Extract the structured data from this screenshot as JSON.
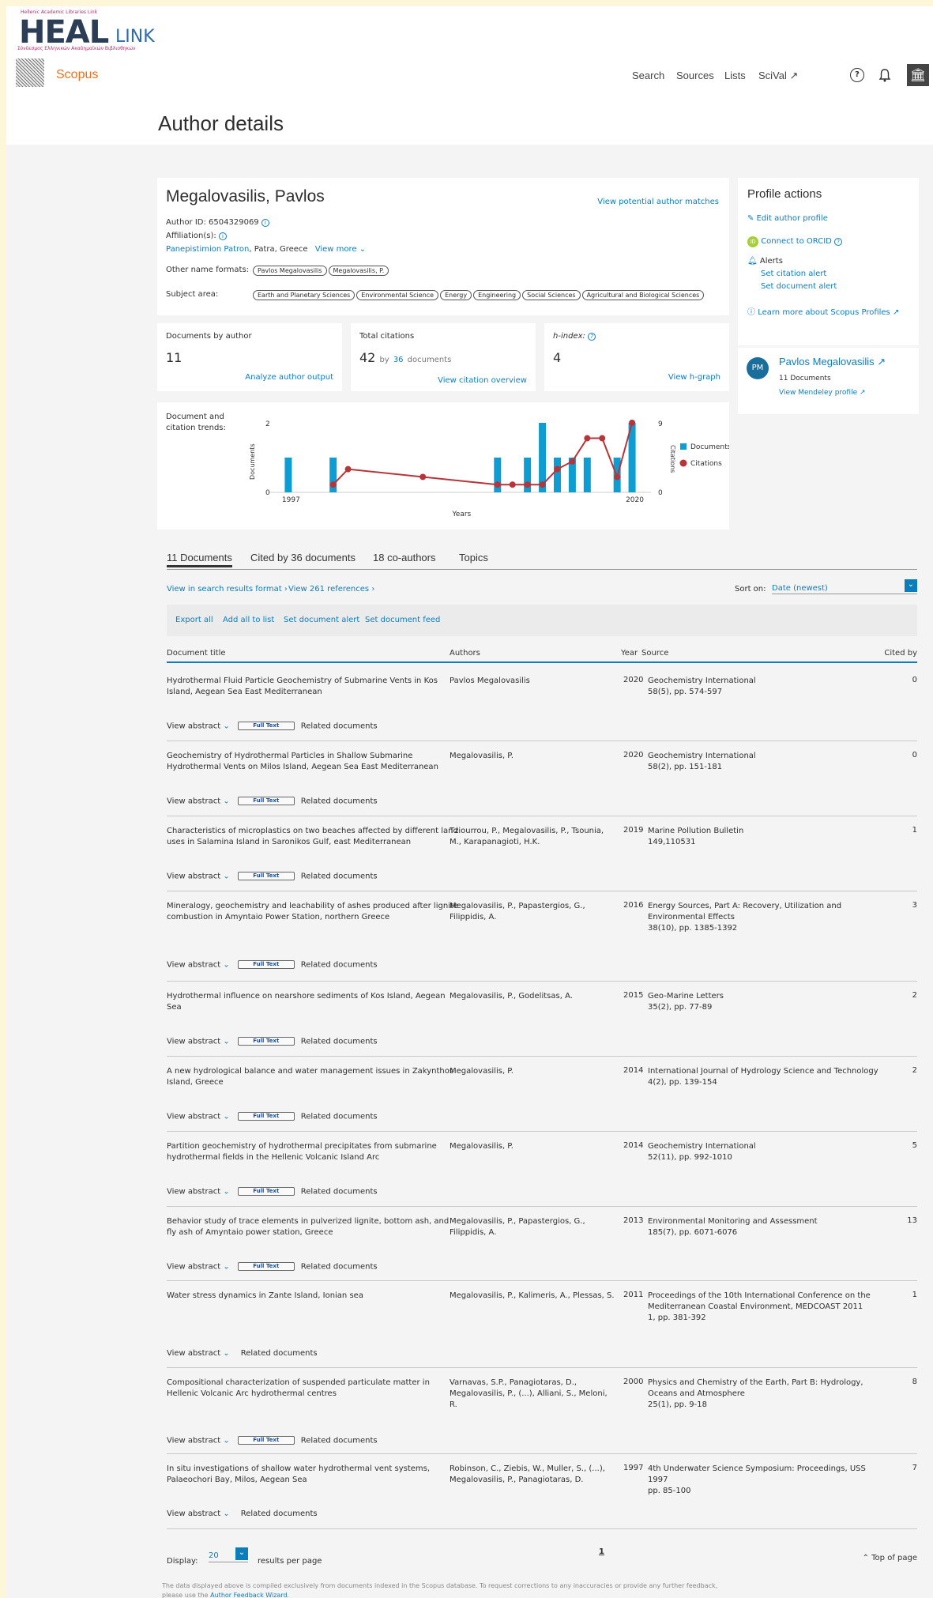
{
  "header": {
    "heal_small": "Hellenic Academic Libraries Link",
    "heal_big": "HEAL",
    "heal_link": "LINK",
    "heal_greek": "Σύνδεσμος Ελληνικών Ακαδημαϊκών Βιβλιοθηκών",
    "brand": "Scopus",
    "nav": [
      "Search",
      "Sources",
      "Lists",
      "SciVal ↗"
    ],
    "help_icon": "?",
    "inst_icon": "🏛"
  },
  "page_title": "Author details",
  "author": {
    "name": "Megalovasilis, Pavlos",
    "author_id": "Author ID: 6504329069",
    "affiliation_label": "Affiliation(s):",
    "affiliation_link": "Panepistimion Patron",
    "affiliation_rest": ", Patra, Greece",
    "view_more": "View more",
    "potential_matches": "View potential author matches",
    "other_names_label": "Other name formats:",
    "other_names": [
      "Pavlos Megalovasilis",
      "Megalovasilis, P."
    ],
    "subject_label": "Subject area:",
    "subjects": [
      "Earth and Planetary Sciences",
      "Environmental Science",
      "Energy",
      "Engineering",
      "Social Sciences",
      "Agricultural and Biological Sciences"
    ]
  },
  "metrics": {
    "docs_label": "Documents by author",
    "docs_value": "11",
    "docs_link": "Analyze author output",
    "cit_label": "Total citations",
    "cit_value": "42",
    "cit_by": "by",
    "cit_docs_num": "36",
    "cit_docs_word": "documents",
    "cit_link": "View citation overview",
    "h_label": "h-index:",
    "h_value": "4",
    "h_link": "View h-graph"
  },
  "profile_actions": {
    "title": "Profile actions",
    "edit": "Edit author profile",
    "orcid": "Connect to ORCID",
    "alerts": "Alerts",
    "citation_alert": "Set citation alert",
    "document_alert": "Set document alert",
    "learn_more": "Learn more about Scopus Profiles"
  },
  "mendeley": {
    "initials": "PM",
    "name": "Pavlos Megalovasilis",
    "docs": "11 Documents",
    "view": "View Mendeley profile"
  },
  "trend_label": "Document and citation trends:",
  "chart_data": {
    "type": "bar",
    "xlabel": "Years",
    "ylabel": "Documents",
    "y2label": "Citations",
    "x_tick_labels": [
      "1997",
      "2020"
    ],
    "ylim": [
      0,
      2
    ],
    "y2lim": [
      0,
      9
    ],
    "y_ticks": [
      "0",
      "2"
    ],
    "y2_ticks": [
      "0",
      "9"
    ],
    "legend_position": "right",
    "series": [
      {
        "name": "Documents",
        "color": "#0e9dd3",
        "kind": "bar",
        "x": [
          1997,
          2000,
          2011,
          2013,
          2014,
          2015,
          2016,
          2017,
          2019,
          2020
        ],
        "values": [
          1,
          1,
          1,
          1,
          2,
          1,
          1,
          1,
          1,
          2
        ]
      },
      {
        "name": "Citations",
        "color": "#b7343a",
        "kind": "line",
        "x": [
          2000,
          2001,
          2006,
          2011,
          2012,
          2013,
          2014,
          2015,
          2016,
          2017,
          2018,
          2019,
          2020
        ],
        "values": [
          1,
          3,
          2,
          1,
          1,
          1,
          1,
          3,
          4,
          7,
          7,
          2,
          9
        ]
      }
    ],
    "xlim": [
      1996,
      2021
    ]
  },
  "tabs": [
    "11 Documents",
    "Cited by 36 documents",
    "18 co-authors",
    "Topics"
  ],
  "search_links": {
    "results_format": "View in search results format",
    "references": "View 261 references"
  },
  "sort": {
    "label": "Sort on:",
    "value": "Date (newest)"
  },
  "toolbar": [
    "Export all",
    "Add all to list",
    "Set document alert",
    "Set document feed"
  ],
  "table_headers": {
    "title": "Document title",
    "authors": "Authors",
    "year": "Year",
    "source": "Source",
    "cited": "Cited by"
  },
  "row_actions": {
    "abstract": "View abstract",
    "fulltext": "Full Text",
    "related": "Related documents"
  },
  "documents": [
    {
      "title": "Hydrothermal Fluid Particle Geochemistry of Submarine Vents in Kos Island, Aegean Sea East Mediterranean",
      "authors": "Pavlos Megalovasilis",
      "year": "2020",
      "source": "Geochemistry International",
      "source2": "58(5), pp. 574-597",
      "cited": "0",
      "fulltext": true
    },
    {
      "title": "Geochemistry of Hydrothermal Particles in Shallow Submarine Hydrothermal Vents on Milos Island, Aegean Sea East Mediterranean",
      "authors": "Megalovasilis, P.",
      "year": "2020",
      "source": "Geochemistry International",
      "source2": "58(2), pp. 151-181",
      "cited": "0",
      "fulltext": true
    },
    {
      "title": "Characteristics of microplastics on two beaches affected by different land uses in Salamina Island in Saronikos Gulf, east Mediterranean",
      "authors": "Tziourrou, P., Megalovasilis, P., Tsounia, M., Karapanagioti, H.K.",
      "year": "2019",
      "source": "Marine Pollution Bulletin",
      "source2": "149,110531",
      "cited": "1",
      "fulltext": true
    },
    {
      "title": "Mineralogy, geochemistry and leachability of ashes produced after lignite combustion in Amyntaio Power Station, northern Greece",
      "authors": "Megalovasilis, P., Papastergios, G., Filippidis, A.",
      "year": "2016",
      "source": "Energy Sources, Part A: Recovery, Utilization and Environmental Effects",
      "source2": "38(10), pp. 1385-1392",
      "cited": "3",
      "fulltext": true
    },
    {
      "title": "Hydrothermal influence on nearshore sediments of Kos Island, Aegean Sea",
      "authors": "Megalovasilis, P., Godelitsas, A.",
      "year": "2015",
      "source": "Geo-Marine Letters",
      "source2": "35(2), pp. 77-89",
      "cited": "2",
      "fulltext": true
    },
    {
      "title": "A new hydrological balance and water management issues in Zakynthos Island, Greece",
      "authors": "Megalovasilis, P.",
      "year": "2014",
      "source": "International Journal of Hydrology Science and Technology",
      "source2": "4(2), pp. 139-154",
      "cited": "2",
      "fulltext": true
    },
    {
      "title": "Partition geochemistry of hydrothermal precipitates from submarine hydrothermal fields in the Hellenic Volcanic Island Arc",
      "authors": "Megalovasilis, P.",
      "year": "2014",
      "source": "Geochemistry International",
      "source2": "52(11), pp. 992-1010",
      "cited": "5",
      "fulltext": true
    },
    {
      "title": "Behavior study of trace elements in pulverized lignite, bottom ash, and fly ash of Amyntaio power station, Greece",
      "authors": "Megalovasilis, P., Papastergios, G., Filippidis, A.",
      "year": "2013",
      "source": "Environmental Monitoring and Assessment",
      "source2": "185(7), pp. 6071-6076",
      "cited": "13",
      "fulltext": true
    },
    {
      "title": "Water stress dynamics in Zante Island, Ionian sea",
      "authors": "Megalovasilis, P., Kalimeris, A., Plessas, S.",
      "year": "2011",
      "source": "Proceedings of the 10th International Conference on the Mediterranean Coastal Environment, MEDCOAST 2011",
      "source2": "1, pp. 381-392",
      "cited": "1",
      "fulltext": false
    },
    {
      "title": "Compositional characterization of suspended particulate matter in Hellenic Volcanic Arc hydrothermal centres",
      "authors": "Varnavas, S.P., Panagiotaras, D., Megalovasilis, P., (...), Alliani, S., Meloni, R.",
      "year": "2000",
      "source": "Physics and Chemistry of the Earth, Part B: Hydrology, Oceans and Atmosphere",
      "source2": "25(1), pp. 9-18",
      "cited": "8",
      "fulltext": true
    },
    {
      "title": "In situ investigations of shallow water hydrothermal vent systems, Palaeochori Bay, Milos, Aegean Sea",
      "authors": "Robinson, C., Ziebis, W., Muller, S., (...), Megalovasilis, P., Panagiotaras, D.",
      "year": "1997",
      "source": "4th Underwater Science Symposium: Proceedings, USS 1997",
      "source2": "pp. 85-100",
      "cited": "7",
      "fulltext": false
    }
  ],
  "footer": {
    "display_label": "Display:",
    "display_value": "20",
    "per_page": "results per page",
    "page": "1",
    "top": "Top of page",
    "note": "The data displayed above is compiled exclusively from documents indexed in the Scopus database. To request corrections to any inaccuracies or provide any further feedback,",
    "note2_a": "please use the ",
    "note2_link": "Author Feedback Wizard",
    "note2_b": "."
  }
}
